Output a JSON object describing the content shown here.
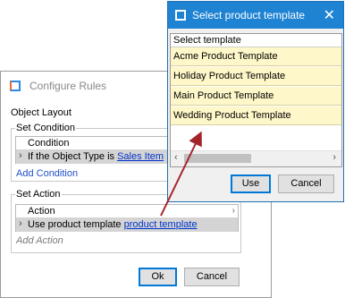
{
  "configure_rules": {
    "title": "Configure Rules",
    "object_layout_label": "Object Layout",
    "set_condition": {
      "group_label": "Set Condition",
      "column_header": "Condition",
      "row_prefix": "If the Object Type is ",
      "row_link": "Sales Item",
      "add_link": "Add Condition"
    },
    "set_action": {
      "group_label": "Set Action",
      "column_header": "Action",
      "row_prefix": "Use product template ",
      "row_link": "product template",
      "add_link": "Add Action"
    },
    "ok_label": "Ok",
    "cancel_label": "Cancel"
  },
  "select_template": {
    "title": "Select product template",
    "close_glyph": "✕",
    "list_header": "Select template",
    "items": [
      "Acme Product Template",
      "Holiday Product Template",
      "Main Product Template",
      "Wedding Product Template"
    ],
    "use_label": "Use",
    "cancel_label": "Cancel"
  },
  "glyphs": {
    "row_marker": "›",
    "scroll_right": "›",
    "scroll_left": "‹"
  },
  "colors": {
    "titlebar_active": "#1e83d3",
    "list_item_bg": "#fef7c9",
    "link": "#0033cc",
    "annotation_arrow": "#a3242b"
  }
}
